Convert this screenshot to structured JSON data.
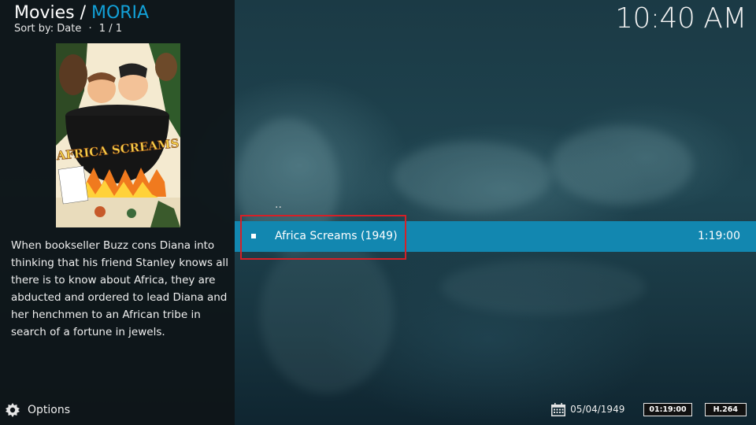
{
  "header": {
    "section": "Movies / ",
    "source": "MORIA",
    "sort_label": "Sort by: Date",
    "separator": "·",
    "page_count": "1 / 1"
  },
  "clock": "10:40 AM",
  "poster": {
    "title_art": "AFRICA SCREAMS"
  },
  "plot": "When bookseller Buzz cons Diana into thinking that his friend Stanley knows all there is to know about Africa, they are abducted and ordered to lead Diana and her henchmen to an African tribe in search of a fortune in jewels.",
  "list": {
    "parent_label": "..",
    "items": [
      {
        "title": "Africa Screams (1949)",
        "duration": "1:19:00",
        "selected": true
      }
    ]
  },
  "footer": {
    "options_label": "Options",
    "options_icon": "gear-icon",
    "date_icon": "calendar-icon",
    "date": "05/04/1949",
    "duration_badge": "01:19:00",
    "codec_badge": "H.264"
  },
  "colors": {
    "accent": "#12a0d7",
    "selection": "#1287b0",
    "highlight_box": "#d62027",
    "panel": "#0e1418"
  }
}
